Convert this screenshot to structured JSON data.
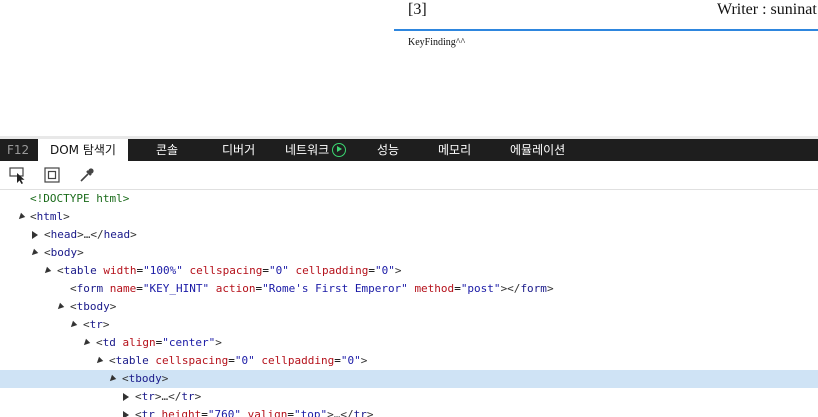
{
  "page": {
    "index": "[3]",
    "writer": "Writer : suninat",
    "key_hint": "KeyFinding^^"
  },
  "devtools": {
    "tabs": {
      "f12": "F12",
      "dom": "DOM 탐색기",
      "console": "콘솔",
      "debugger": "디버거",
      "network": "네트워크",
      "performance": "성능",
      "memory": "메모리",
      "emulation": "에뮬레이션"
    },
    "tree": {
      "doctype": "<!DOCTYPE html>",
      "html": "html",
      "head": "head",
      "ellipsis": "…",
      "body": "body",
      "table1": {
        "tag": "table",
        "a1": "width",
        "v1": "\"100%\"",
        "a2": "cellspacing",
        "v2": "\"0\"",
        "a3": "cellpadding",
        "v3": "\"0\""
      },
      "form": {
        "tag": "form",
        "a1": "name",
        "v1": "\"KEY_HINT\"",
        "a2": "action",
        "v2": "\"Rome's First Emperor\"",
        "a3": "method",
        "v3": "\"post\""
      },
      "tbody": "tbody",
      "tr": "tr",
      "td": {
        "tag": "td",
        "a1": "align",
        "v1": "\"center\""
      },
      "table2": {
        "tag": "table",
        "a1": "cellspacing",
        "v1": "\"0\"",
        "a2": "cellpadding",
        "v2": "\"0\""
      },
      "tr_last": {
        "tag": "tr",
        "a1": "height",
        "v1": "\"760\"",
        "a2": "valign",
        "v2": "\"top\""
      }
    }
  }
}
